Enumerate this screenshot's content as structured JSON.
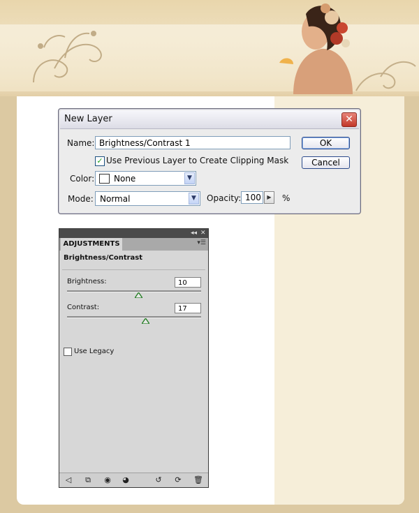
{
  "dialog": {
    "title": "New Layer",
    "close_label": "✕",
    "name_label": "Name:",
    "name_value": "Brightness/Contrast 1",
    "clip_label": "Use Previous Layer to Create Clipping Mask",
    "clip_checked": true,
    "color_label": "Color:",
    "color_value": "None",
    "mode_label": "Mode:",
    "mode_value": "Normal",
    "opacity_label": "Opacity:",
    "opacity_value": "100",
    "opacity_unit": "%",
    "ok_label": "OK",
    "cancel_label": "Cancel"
  },
  "panel": {
    "tab_label": "ADJUSTMENTS",
    "title": "Brightness/Contrast",
    "brightness_label": "Brightness:",
    "brightness_value": "10",
    "contrast_label": "Contrast:",
    "contrast_value": "17",
    "legacy_label": "Use Legacy",
    "legacy_checked": false
  },
  "colors": {
    "page_bg": "#dcc9a2",
    "right_column": "#f6eed9",
    "panel_bg": "#d7d7d7",
    "accent_green": "#21a121"
  },
  "icons": [
    "back-arrow-icon",
    "clip-toggle-icon",
    "visibility-toggle-icon",
    "eye-icon",
    "view-previous-icon",
    "reset-icon",
    "trash-icon"
  ]
}
